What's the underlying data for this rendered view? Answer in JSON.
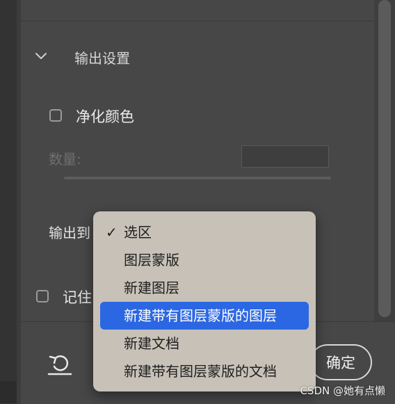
{
  "section": {
    "title": "输出设置",
    "expanded": true
  },
  "decontaminate": {
    "label": "净化颜色",
    "checked": false
  },
  "amount": {
    "label": "数量:",
    "value": ""
  },
  "output": {
    "label": "输出到"
  },
  "remember": {
    "label": "记住",
    "checked": false
  },
  "dropdown": {
    "checked_item": "选区",
    "highlighted_item": "新建带有图层蒙版的图层",
    "items": [
      "选区",
      "图层蒙版",
      "新建图层",
      "新建带有图层蒙版的图层",
      "新建文档",
      "新建带有图层蒙版的文档"
    ]
  },
  "buttons": {
    "ok": "确定"
  },
  "watermark": "CSDN @她有点懒",
  "colors": {
    "highlight": "#2c67e3",
    "panel": "#474747",
    "menu": "#c7c1b8"
  },
  "icons": {
    "toggle": "chevron-down-icon",
    "reset": "reset-icon",
    "check": "checkmark-icon"
  }
}
